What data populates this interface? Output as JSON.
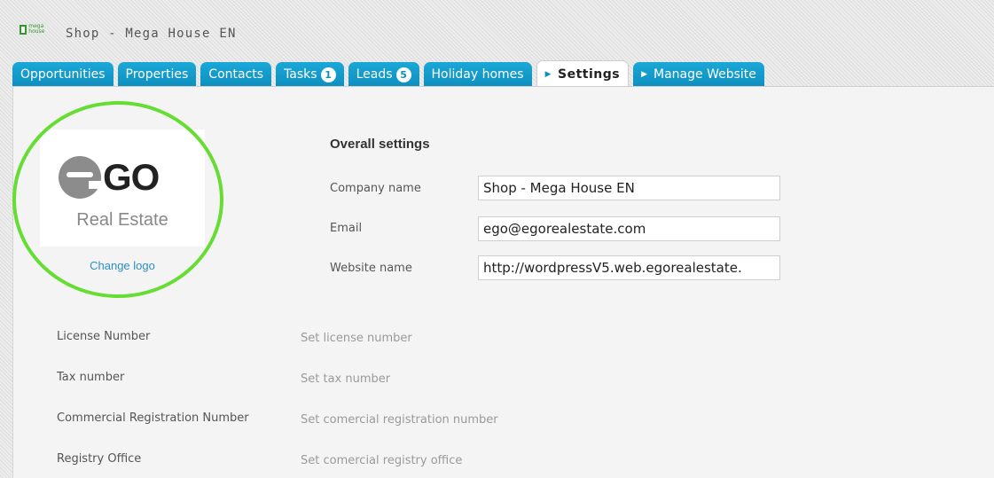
{
  "header": {
    "brand_logo_text": "mega house",
    "shop_title": "Shop - Mega House EN"
  },
  "tabs": [
    {
      "label": "Opportunities"
    },
    {
      "label": "Properties"
    },
    {
      "label": "Contacts"
    },
    {
      "label": "Tasks",
      "badge": "1"
    },
    {
      "label": "Leads",
      "badge": "5"
    },
    {
      "label": "Holiday homes"
    },
    {
      "label": "Settings",
      "active": true
    },
    {
      "label": "Manage Website"
    }
  ],
  "logo": {
    "mark_text": "GO",
    "subtitle": "Real Estate",
    "change_label": "Change logo"
  },
  "overall": {
    "title": "Overall settings",
    "company_label": "Company name",
    "company_value": "Shop - Mega House EN",
    "email_label": "Email",
    "email_value": "ego@egorealestate.com",
    "website_label": "Website name",
    "website_value": "http://wordpressV5.web.egorealestate."
  },
  "rows": [
    {
      "label": "License Number",
      "value": "Set license number"
    },
    {
      "label": "Tax number",
      "value": "Set tax number"
    },
    {
      "label": "Commercial Registration Number",
      "value": "Set comercial registration number"
    },
    {
      "label": "Registry Office",
      "value": "Set comercial registry office"
    }
  ],
  "colors": {
    "tab_blue": "#0d8fc0",
    "highlight_green": "#66dd33",
    "link_blue": "#2b8fc6"
  }
}
